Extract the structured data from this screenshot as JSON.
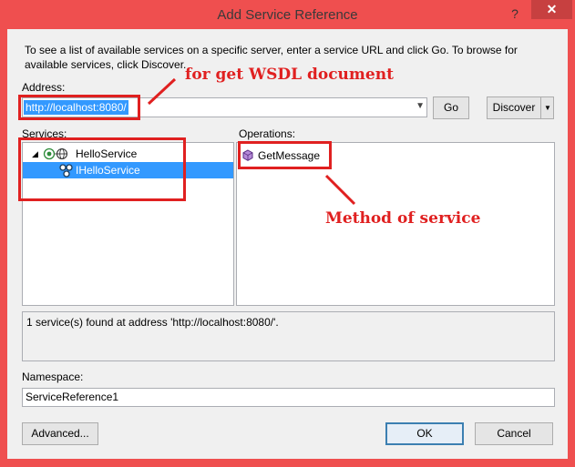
{
  "window": {
    "title": "Add Service Reference",
    "help_glyph": "?",
    "close_glyph": "✕"
  },
  "intro_text": "To see a list of available services on a specific server, enter a service URL and click Go. To browse for available services, click Discover.",
  "address": {
    "label": "Address:",
    "value": "http://localhost:8080/",
    "go_label": "Go",
    "discover_label": "Discover"
  },
  "services": {
    "label": "Services:",
    "items": [
      {
        "label": "HelloService",
        "expander": "◢",
        "icon": "service-icon"
      },
      {
        "label": "IHelloService",
        "icon": "interface-icon",
        "selected": true
      }
    ]
  },
  "operations": {
    "label": "Operations:",
    "items": [
      {
        "label": "GetMessage",
        "icon": "method-icon"
      }
    ]
  },
  "status_text": "1 service(s) found at address 'http://localhost:8080/'.",
  "namespace": {
    "label": "Namespace:",
    "value": "ServiceReference1"
  },
  "buttons": {
    "advanced": "Advanced...",
    "ok": "OK",
    "cancel": "Cancel"
  },
  "annotations": {
    "wsdl": "for get WSDL document",
    "method": "Method of  service"
  },
  "colors": {
    "frame": "#ef4f4f",
    "selection": "#3399ff",
    "annotation": "#e02020"
  }
}
